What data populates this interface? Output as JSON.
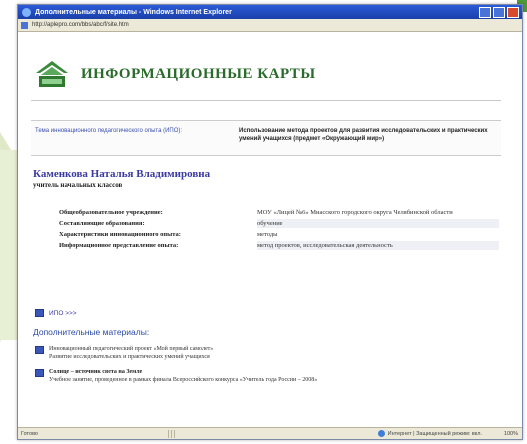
{
  "window": {
    "title": "Дополнительные материалы - Windows Internet Explorer",
    "address": "http://aplepro.com/bbs/abc/f/site.htm"
  },
  "header": {
    "logo_title": "ИНФОРМАЦИОННЫЕ КАРТЫ"
  },
  "theme": {
    "label": "Тема инновационного педагогического опыта (ИПО):",
    "value": "Использование метода проектов для развития исследовательских и практических умений учащихся (предмет «Окружающий мир»)"
  },
  "author": {
    "name": "Каменкова Наталья Владимировна",
    "role": "учитель начальных классов"
  },
  "info_rows": [
    {
      "key": "Общеобразовательное учреждение:",
      "value": "МОУ «Лицей №6» Миасского городского округа Челябинской области"
    },
    {
      "key": "Составляющие образования:",
      "value": "обучение"
    },
    {
      "key": "Характеристики инновационного опыта:",
      "value": "методы"
    },
    {
      "key": "Информационное представление опыта:",
      "value": "метод проектов, исследовательская деятельность"
    }
  ],
  "more_link": "ИПО >>>",
  "extra": {
    "title": "Дополнительные материалы:",
    "items": [
      {
        "title": "Инновационный педагогический проект «Мой первый самолет»",
        "desc": "Развитие исследовательских и практических умений учащихся"
      },
      {
        "title": "Солнце – источник света на Земле",
        "desc": "Учебное занятие, проведенное в рамках финала Всероссийского конкурса «Учитель года России – 2008»"
      }
    ]
  },
  "status": {
    "left": "Готово",
    "zone": "Интернет | Защищенный режим: вкл.",
    "zoom": "100%"
  }
}
